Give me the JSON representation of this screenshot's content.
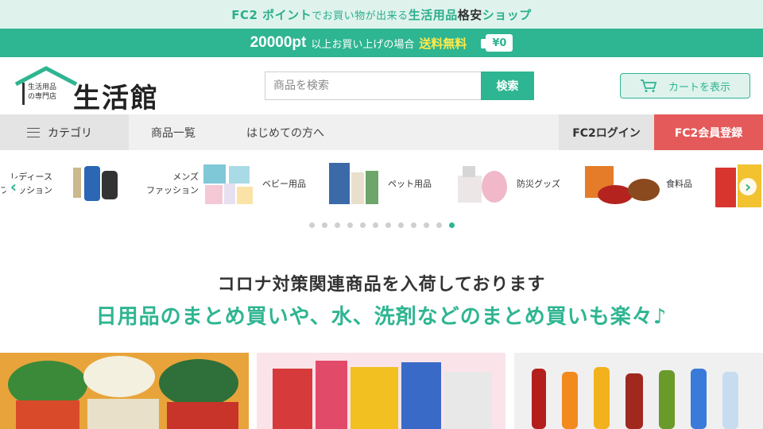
{
  "top_banner": {
    "fc2": "FC2 ポイント",
    "middle": "でお買い物が出来る",
    "highlight": "生活用品",
    "bold": "格安",
    "tail": "ショップ"
  },
  "promo": {
    "points": "20000pt",
    "condition": "以上お買い上げの場合",
    "free_shipping": "送料無料",
    "price": "¥0"
  },
  "logo": {
    "sub_line1": "生活用品",
    "sub_line2": "の専門店",
    "name": "生活館"
  },
  "search": {
    "placeholder": "商品を検索",
    "button": "検索"
  },
  "cart_button": "カートを表示",
  "nav": {
    "category": "カテゴリ",
    "links": [
      "商品一覧",
      "はじめての方へ"
    ],
    "login": "FC2ログイン",
    "register": "FC2会員登録"
  },
  "categories": [
    {
      "label": "レディース\nファッション"
    },
    {
      "label": "メンズ\nファッション"
    },
    {
      "label": "ベビー用品"
    },
    {
      "label": "ペット用品"
    },
    {
      "label": "防災グッズ"
    },
    {
      "label": "食料品"
    }
  ],
  "carousel": {
    "total_dots": 12,
    "active_dot": 11
  },
  "messages": {
    "line1": "コロナ対策関連商品を入荷しております",
    "line2": "日用品のまとめ買いや、水、洗剤などのまとめ買いも楽々♪"
  },
  "colors": {
    "accent": "#2eb591",
    "register": "#e45a5a",
    "light_accent": "#dff3ec"
  }
}
